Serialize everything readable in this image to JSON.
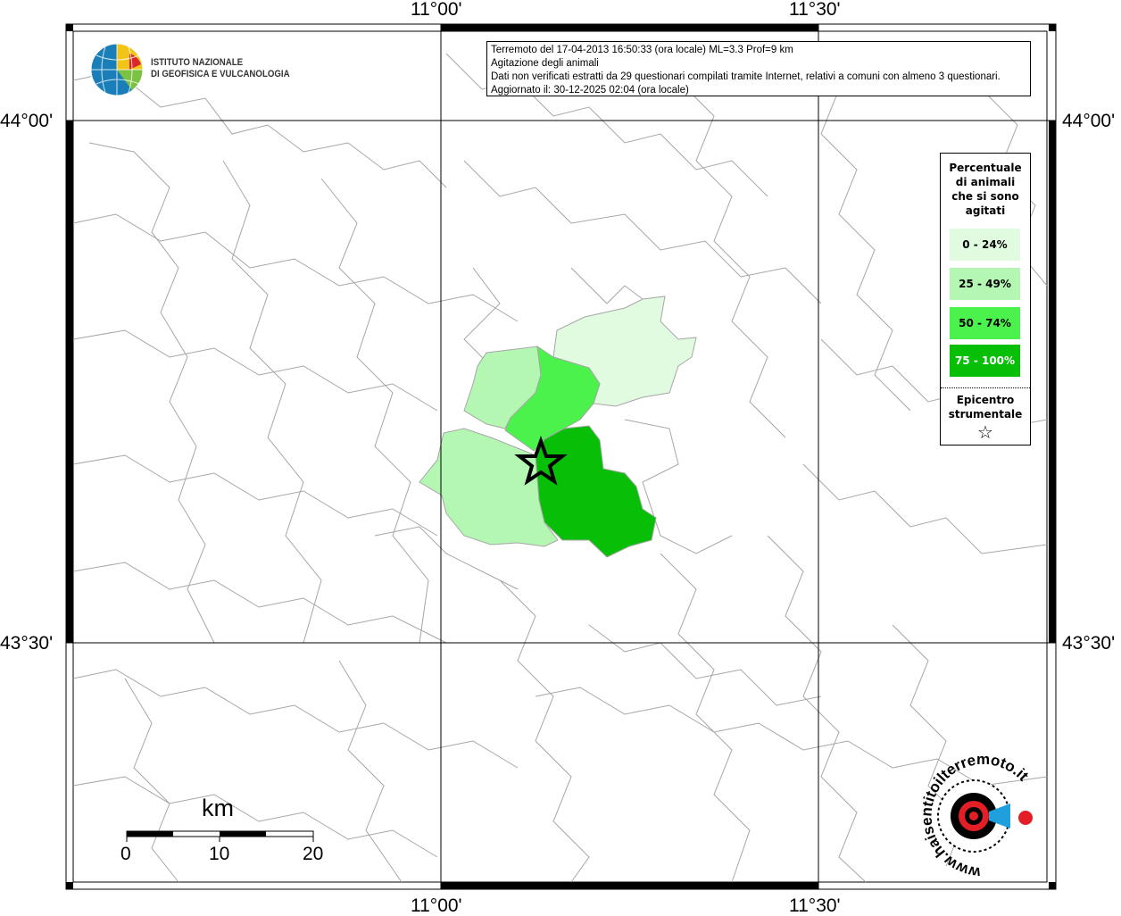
{
  "coordinates": {
    "lon_left": "11°00'",
    "lon_right": "11°30'",
    "lat_top": "44°00'",
    "lat_bottom": "43°30'"
  },
  "institute": {
    "line1": "ISTITUTO NAZIONALE",
    "line2": "DI GEOFISICA E VULCANOLOGIA"
  },
  "info": {
    "line1": "Terremoto del 17-04-2013 16:50:33 (ora locale) ML=3.3 Prof=9 km",
    "line2": "Agitazione degli animali",
    "line3": "Dati non verificati estratti da 29 questionari compilati tramite Internet, relativi a comuni con almeno 3 questionari.",
    "line4": "Aggiornato il: 30-12-2025 02:04 (ora locale)"
  },
  "legend": {
    "title_lines": [
      "Percentuale",
      "di animali",
      "che si sono",
      "agitati"
    ],
    "classes": [
      {
        "label": "0 - 24%",
        "color": "#e0fbe0",
        "text_color": "#000000"
      },
      {
        "label": "25 - 49%",
        "color": "#b3f7b3",
        "text_color": "#000000"
      },
      {
        "label": "50 - 74%",
        "color": "#4cf24c",
        "text_color": "#000000"
      },
      {
        "label": "75 - 100%",
        "color": "#06bf06",
        "text_color": "#ffffff"
      }
    ],
    "epicenter_lines": [
      "Epicentro",
      "strumentale"
    ],
    "epicenter_symbol": "☆"
  },
  "scale": {
    "title": "km",
    "ticks": [
      "0",
      "10",
      "20"
    ]
  },
  "logo": {
    "text": "www.haisentitoilterremoto.it",
    "colors": {
      "red": "#e41e26",
      "blue": "#1fa0dc",
      "black": "#000000"
    }
  },
  "map_colors": {
    "border": "#a6a6a6",
    "grid": "#000000",
    "frame_bar": "#000000"
  }
}
